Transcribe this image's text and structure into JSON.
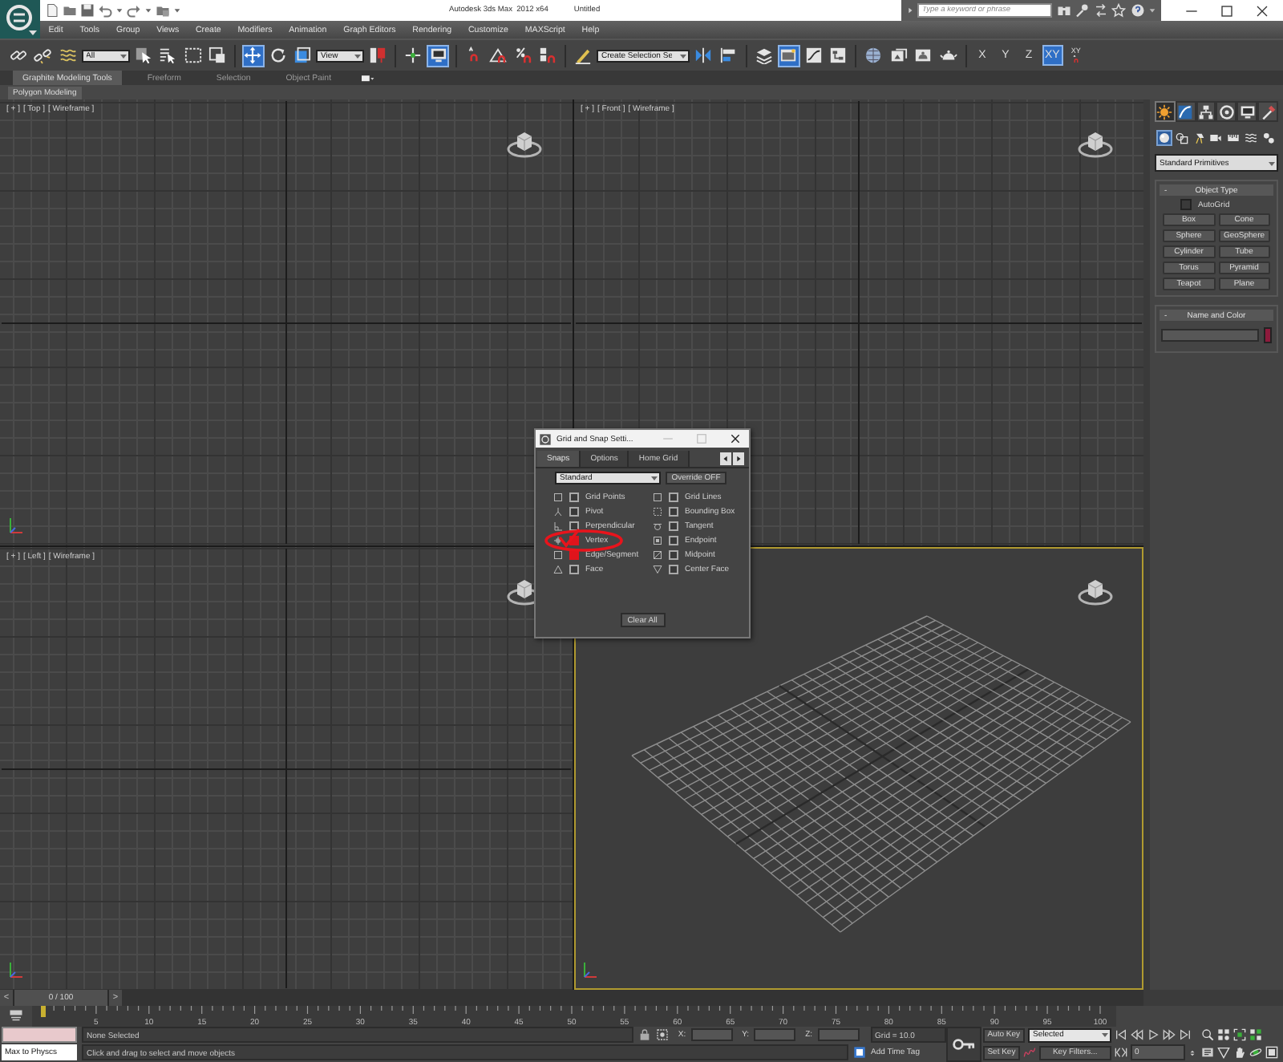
{
  "title_bar": {
    "app_title": "Autodesk 3ds Max  2012 x64",
    "file_name": "Untitled",
    "search": {
      "placeholder": "Type a keyword or phrase"
    }
  },
  "menu_bar": [
    "Edit",
    "Tools",
    "Group",
    "Views",
    "Create",
    "Modifiers",
    "Animation",
    "Graph Editors",
    "Rendering",
    "Customize",
    "MAXScript",
    "Help"
  ],
  "main_toolbar": {
    "groups": [
      [
        {
          "kind": "link",
          "selected": false
        },
        {
          "kind": "unlink",
          "selected": false
        },
        {
          "kind": "bind",
          "selected": false
        },
        {
          "kind": "dropdown",
          "value": "All"
        },
        {
          "kind": "select",
          "selected": false
        },
        {
          "kind": "select_by_name",
          "selected": false
        },
        {
          "kind": "region",
          "selected": false
        },
        {
          "kind": "crossing",
          "selected": false
        }
      ],
      [
        {
          "kind": "move",
          "selected": true
        },
        {
          "kind": "rotate",
          "selected": false
        },
        {
          "kind": "scale",
          "selected": false
        },
        {
          "kind": "dropdown",
          "value": "View"
        },
        {
          "kind": "pivot",
          "selected": false
        }
      ],
      [
        {
          "kind": "manipulate",
          "selected": false
        },
        {
          "kind": "shortcut",
          "selected": true
        }
      ],
      [
        {
          "kind": "snap",
          "selected": false
        },
        {
          "kind": "angle_snap",
          "selected": false
        },
        {
          "kind": "percent_snap",
          "selected": false
        },
        {
          "kind": "spinner_snap",
          "selected": false
        }
      ],
      [
        {
          "kind": "edit_named",
          "selected": false
        },
        {
          "kind": "dropdown",
          "value": "Create Selection Se"
        },
        {
          "kind": "mirror",
          "selected": false
        },
        {
          "kind": "align",
          "selected": false
        }
      ],
      [
        {
          "kind": "layers",
          "selected": false
        },
        {
          "kind": "ribbon",
          "selected": true
        },
        {
          "kind": "curve_editor",
          "selected": false
        },
        {
          "kind": "schematic",
          "selected": false
        }
      ],
      [
        {
          "kind": "material",
          "selected": false
        },
        {
          "kind": "render_setup",
          "selected": false
        },
        {
          "kind": "frame_window",
          "selected": false
        },
        {
          "kind": "render",
          "selected": false
        }
      ],
      [
        {
          "kind": "axis",
          "label": "X",
          "selected": false
        },
        {
          "kind": "axis",
          "label": "Y",
          "selected": false
        },
        {
          "kind": "axis",
          "label": "Z",
          "selected": false
        },
        {
          "kind": "axis",
          "label": "XY",
          "selected": true
        },
        {
          "kind": "axis_snap",
          "label": "XY",
          "selected": false
        }
      ]
    ]
  },
  "ribbon": {
    "tabs": [
      {
        "label": "Graphite Modeling Tools",
        "selected": true
      },
      {
        "label": "Freeform",
        "selected": false
      },
      {
        "label": "Selection",
        "selected": false
      },
      {
        "label": "Object Paint",
        "selected": false
      }
    ],
    "panel": "Polygon Modeling"
  },
  "viewports": [
    {
      "kind": "ortho",
      "labels": {
        "general": "[ + ]",
        "point_of_view": "[ Top ]",
        "shading": "[ Wireframe ]"
      },
      "active": false
    },
    {
      "kind": "ortho",
      "labels": {
        "general": "[ + ]",
        "point_of_view": "[ Front ]",
        "shading": "[ Wireframe ]"
      },
      "active": false
    },
    {
      "kind": "ortho",
      "labels": {
        "general": "[ + ]",
        "point_of_view": "[ Left ]",
        "shading": "[ Wireframe ]"
      },
      "active": false
    },
    {
      "kind": "perspective",
      "active": true
    }
  ],
  "command_panel": {
    "tabs": [
      {
        "kind": "create",
        "selected": true
      },
      {
        "kind": "modify",
        "selected": false
      },
      {
        "kind": "hierarchy",
        "selected": false
      },
      {
        "kind": "motion",
        "selected": false
      },
      {
        "kind": "display",
        "selected": false
      },
      {
        "kind": "utilities",
        "selected": false
      }
    ],
    "categories": [
      {
        "kind": "geometry",
        "selected": true
      },
      {
        "kind": "shapes",
        "selected": false
      },
      {
        "kind": "lights",
        "selected": false
      },
      {
        "kind": "cameras",
        "selected": false
      },
      {
        "kind": "helpers",
        "selected": false
      },
      {
        "kind": "space_warps",
        "selected": false
      },
      {
        "kind": "systems",
        "selected": false
      }
    ],
    "object_category": "Standard Primitives",
    "rollouts": [
      {
        "kind": "object_type",
        "toggle": "-",
        "title": "Object Type",
        "autogrid": {
          "label": "AutoGrid",
          "checked": false
        },
        "buttons": [
          "Box",
          "Cone",
          "Sphere",
          "GeoSphere",
          "Cylinder",
          "Tube",
          "Torus",
          "Pyramid",
          "Teapot",
          "Plane"
        ]
      },
      {
        "kind": "name_and_color",
        "toggle": "-",
        "title": "Name and Color",
        "color": "#8e1a3c"
      }
    ]
  },
  "snap_dialog": {
    "title": "Grid and Snap Setti...",
    "tabs": [
      {
        "label": "Snaps",
        "selected": true
      },
      {
        "label": "Options",
        "selected": false
      },
      {
        "label": "Home Grid",
        "selected": false
      }
    ],
    "snap_type": "Standard",
    "override": "Override OFF",
    "snaps": [
      {
        "kind": "grid_points",
        "label": "Grid Points",
        "checked": false
      },
      {
        "kind": "grid_lines",
        "label": "Grid Lines",
        "checked": false
      },
      {
        "kind": "pivot",
        "label": "Pivot",
        "checked": false
      },
      {
        "kind": "bounding_box",
        "label": "Bounding Box",
        "checked": false
      },
      {
        "kind": "perpendicular",
        "label": "Perpendicular",
        "checked": false
      },
      {
        "kind": "tangent",
        "label": "Tangent",
        "checked": false
      },
      {
        "kind": "vertex",
        "label": "Vertex",
        "checked": true
      },
      {
        "kind": "endpoint",
        "label": "Endpoint",
        "checked": false
      },
      {
        "kind": "edge",
        "label": "Edge/Segment",
        "checked": true
      },
      {
        "kind": "midpoint",
        "label": "Midpoint",
        "checked": false
      },
      {
        "kind": "face",
        "label": "Face",
        "checked": false
      },
      {
        "kind": "center_face",
        "label": "Center Face",
        "checked": false
      }
    ],
    "clear_button": "Clear All"
  },
  "time_slider": {
    "prev": "<",
    "label": "0 / 100",
    "next": ">",
    "level": 0
  },
  "track_bar": {
    "labels": [
      "5",
      "10",
      "15",
      "20",
      "25",
      "30",
      "35",
      "40",
      "45",
      "50",
      "55",
      "60",
      "65",
      "70",
      "75",
      "80",
      "85",
      "90",
      "95",
      "100"
    ]
  },
  "status_bar": {
    "listener_output": "Max to Physcs",
    "selection": "None Selected",
    "prompt": "Click and drag to select and move objects",
    "coordinates": [
      "X:",
      "Y:",
      "Z:"
    ],
    "grid": "Grid = 10.0",
    "time_tag": "Add Time Tag",
    "auto_key": {
      "label": "Auto Key",
      "on": false
    },
    "key_mode": "Selected",
    "set_key": "Set Key",
    "key_filters": "Key Filters...",
    "frame": "0"
  }
}
